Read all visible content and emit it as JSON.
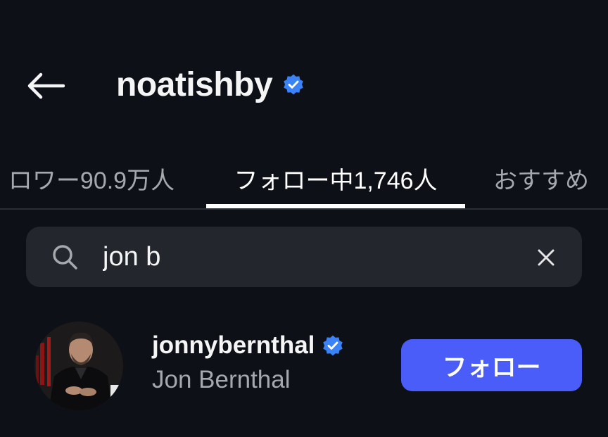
{
  "header": {
    "title": "noatishby",
    "back_icon": "back-arrow-icon",
    "verified_icon": "verified-badge-icon",
    "verified_color": "#3b82f6"
  },
  "tabs": [
    {
      "label": "ロワー90.9万人",
      "active": false
    },
    {
      "label": "フォロー中1,746人",
      "active": true
    },
    {
      "label": "おすすめ",
      "active": false
    }
  ],
  "search": {
    "value": "jon b",
    "search_icon": "search-icon",
    "clear_icon": "close-icon"
  },
  "results": [
    {
      "username": "jonnybernthal",
      "full_name": "Jon Bernthal",
      "verified": true,
      "follow_label": "フォロー"
    }
  ],
  "colors": {
    "background": "#0d1016",
    "search_bg": "#23262c",
    "follow_button": "#4a5df9",
    "muted_text": "#a5a8ad"
  }
}
